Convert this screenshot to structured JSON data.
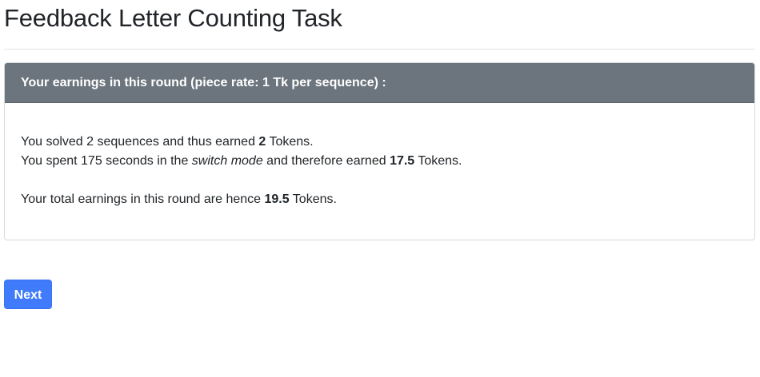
{
  "page": {
    "title": "Feedback Letter Counting Task"
  },
  "card": {
    "header": "Your earnings in this round (piece rate: 1 Tk per sequence) :",
    "line1": {
      "prefix": "You solved 2 sequences and thus earned ",
      "amount": "2",
      "suffix": " Tokens."
    },
    "line2": {
      "prefix": "You spent 175 seconds in the ",
      "mode": "switch mode",
      "middle": " and therefore earned ",
      "amount": "17.5",
      "suffix": " Tokens."
    },
    "line3": {
      "prefix": "Your total earnings in this round are hence ",
      "amount": "19.5",
      "suffix": " Tokens."
    }
  },
  "buttons": {
    "next_label": "Next"
  },
  "colors": {
    "card_header_bg": "#6c757d",
    "button_bg": "#3f7bfa"
  }
}
